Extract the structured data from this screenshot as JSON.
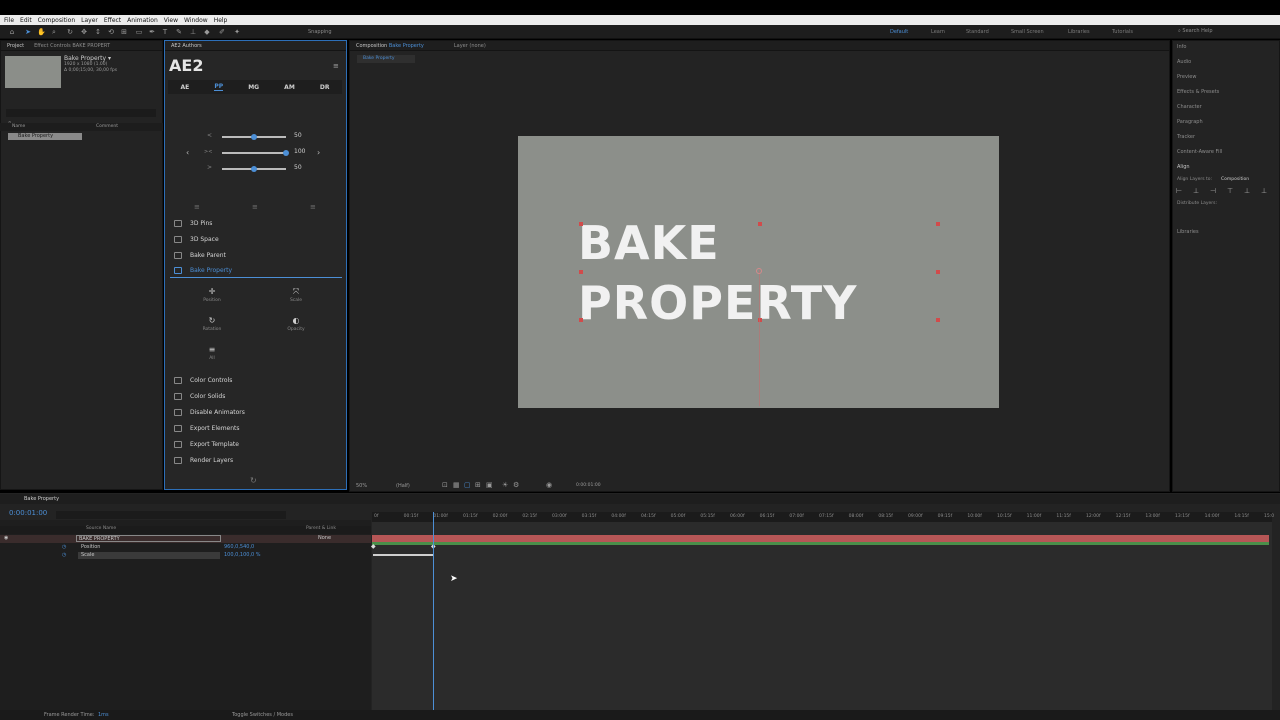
{
  "menu": [
    "File",
    "Edit",
    "Composition",
    "Layer",
    "Effect",
    "Animation",
    "View",
    "Window",
    "Help"
  ],
  "toolbar": {
    "snapping": "Snapping",
    "workspaces": [
      "Default",
      "Learn",
      "Standard",
      "Small Screen",
      "Libraries",
      "Tutorials"
    ],
    "search_help": "Search Help"
  },
  "project": {
    "tab_project": "Project",
    "tab_effect_controls": "Effect Controls BAKE PROPERT",
    "item_name": "Bake Property ▾",
    "item_info1": "1920 x 1080 (1.00)",
    "item_info2": "Δ 0;00;15;00, 30,00 fps",
    "col_name": "Name",
    "col_comment": "Comment",
    "row_name": "Bake Property"
  },
  "ae2": {
    "panel_tab": "AE2 Authors",
    "title": "AE2",
    "tabs": [
      "AE",
      "PP",
      "MG",
      "AM",
      "DR"
    ],
    "active_tab": "PP",
    "slider_values": [
      "50",
      "100",
      "50"
    ],
    "slider_fill": [
      0.5,
      1.0,
      0.5
    ],
    "items": [
      {
        "label": "3D Pins",
        "selected": false
      },
      {
        "label": "3D Space",
        "selected": false
      },
      {
        "label": "Bake Parent",
        "selected": false
      },
      {
        "label": "Bake Property",
        "selected": true
      }
    ],
    "sub_buttons": [
      "Position",
      "Scale",
      "Rotation",
      "Opacity",
      "All"
    ],
    "items2": [
      "Color Controls",
      "Color Solids",
      "Disable Animators",
      "Export Elements",
      "Export Template",
      "Render Layers"
    ]
  },
  "composition": {
    "tab_label": "Composition",
    "tab_name": "Bake Property",
    "layer_tab": "Layer (none)",
    "crumb": "Bake Property",
    "text_line1": "BAKE",
    "text_line2": "PROPERTY",
    "zoom": "50%",
    "quality": "(Half)",
    "timecode": "0:00:01:00"
  },
  "right_panels": [
    "Info",
    "Audio",
    "Preview",
    "Effects & Presets",
    "Character",
    "Paragraph",
    "Tracker",
    "Content-Aware Fill",
    "Align",
    "Align Layers to:",
    "Distribute Layers:",
    "Libraries"
  ],
  "align_target": "Composition",
  "timeline": {
    "tab": "Bake Property",
    "timecode": "0:00:01:00",
    "col_source": "Source Name",
    "col_parent": "Parent & Link",
    "layer_name": "BAKE PROPERTY",
    "parent_value": "None",
    "prop1": "Position",
    "prop1_value": "960,0,540,0",
    "prop2": "Scale",
    "prop2_value": "100,0,100,0 %",
    "ticks": [
      "0f",
      "00:15f",
      "01:00f",
      "01:15f",
      "02:00f",
      "02:15f",
      "03:00f",
      "03:15f",
      "04:00f",
      "04:15f",
      "05:00f",
      "05:15f",
      "06:00f",
      "06:15f",
      "07:00f",
      "07:15f",
      "08:00f",
      "08:15f",
      "09:00f",
      "09:15f",
      "10:00f",
      "10:15f",
      "11:00f",
      "11:15f",
      "12:00f",
      "12:15f",
      "13:00f",
      "13:15f",
      "14:00f",
      "14:15f",
      "15:0"
    ]
  },
  "status": {
    "render_label": "Frame Render Time:",
    "render_value": "1ms",
    "toggle": "Toggle Switches / Modes"
  },
  "colors": {
    "accent": "#4c8fd6",
    "layer_bar": "#b65656",
    "canvas": "#8c8f8a"
  }
}
